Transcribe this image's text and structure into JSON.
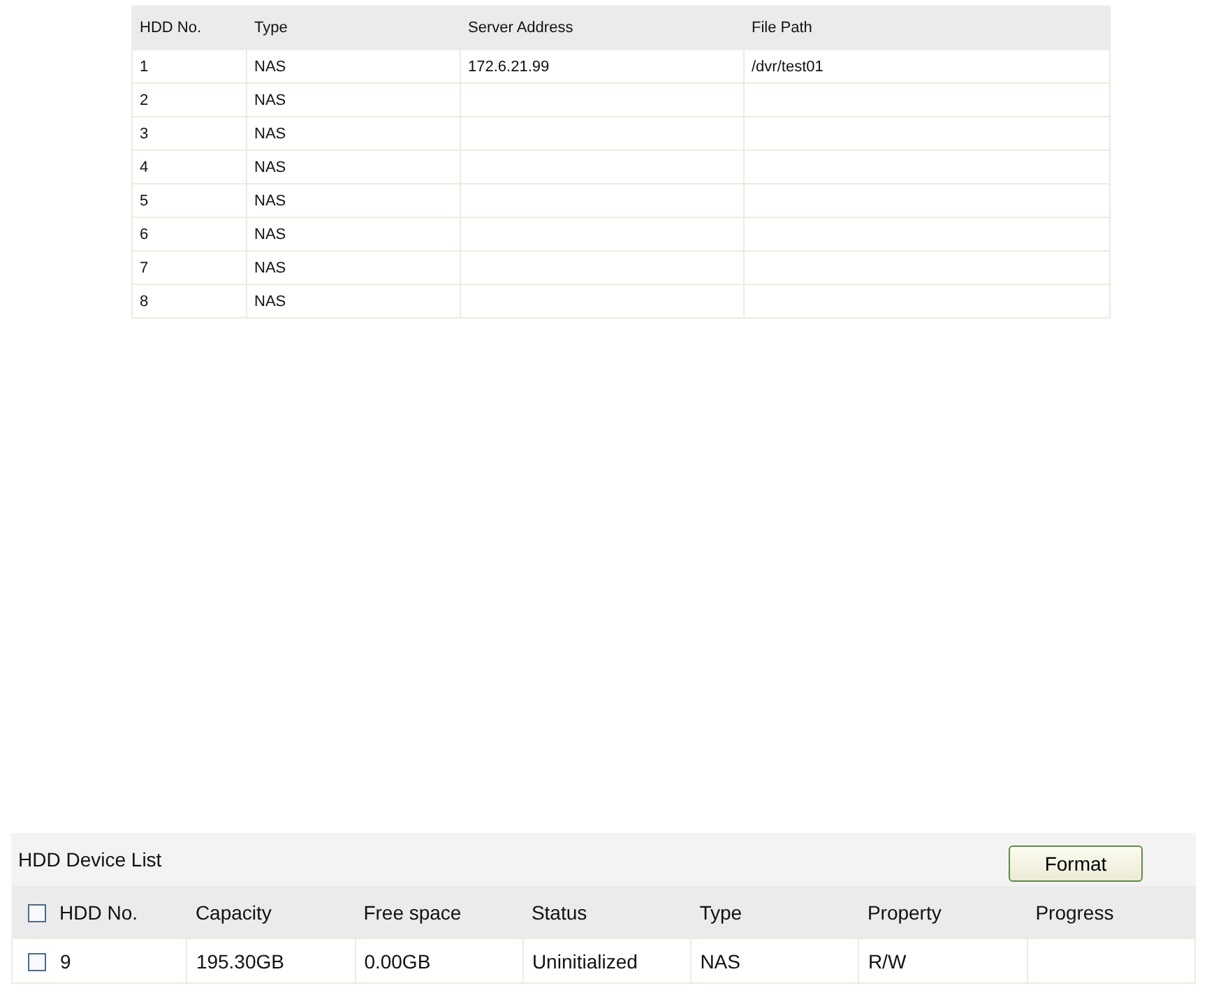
{
  "nas_table": {
    "columns": [
      "HDD No.",
      "Type",
      "Server Address",
      "File Path"
    ],
    "rows": [
      [
        "1",
        "NAS",
        "172.6.21.99",
        "/dvr/test01"
      ],
      [
        "2",
        "NAS",
        "",
        ""
      ],
      [
        "3",
        "NAS",
        "",
        ""
      ],
      [
        "4",
        "NAS",
        "",
        ""
      ],
      [
        "5",
        "NAS",
        "",
        ""
      ],
      [
        "6",
        "NAS",
        "",
        ""
      ],
      [
        "7",
        "NAS",
        "",
        ""
      ],
      [
        "8",
        "NAS",
        "",
        ""
      ]
    ]
  },
  "device_list": {
    "title": "HDD Device List",
    "format_button": "Format",
    "select_all_checked": false,
    "columns": [
      "HDD No.",
      "Capacity",
      "Free space",
      "Status",
      "Type",
      "Property",
      "Progress"
    ],
    "rows": [
      {
        "checked": false,
        "cells": [
          "9",
          "195.30GB",
          "0.00GB",
          "Uninitialized",
          "NAS",
          "R/W",
          ""
        ]
      }
    ]
  }
}
